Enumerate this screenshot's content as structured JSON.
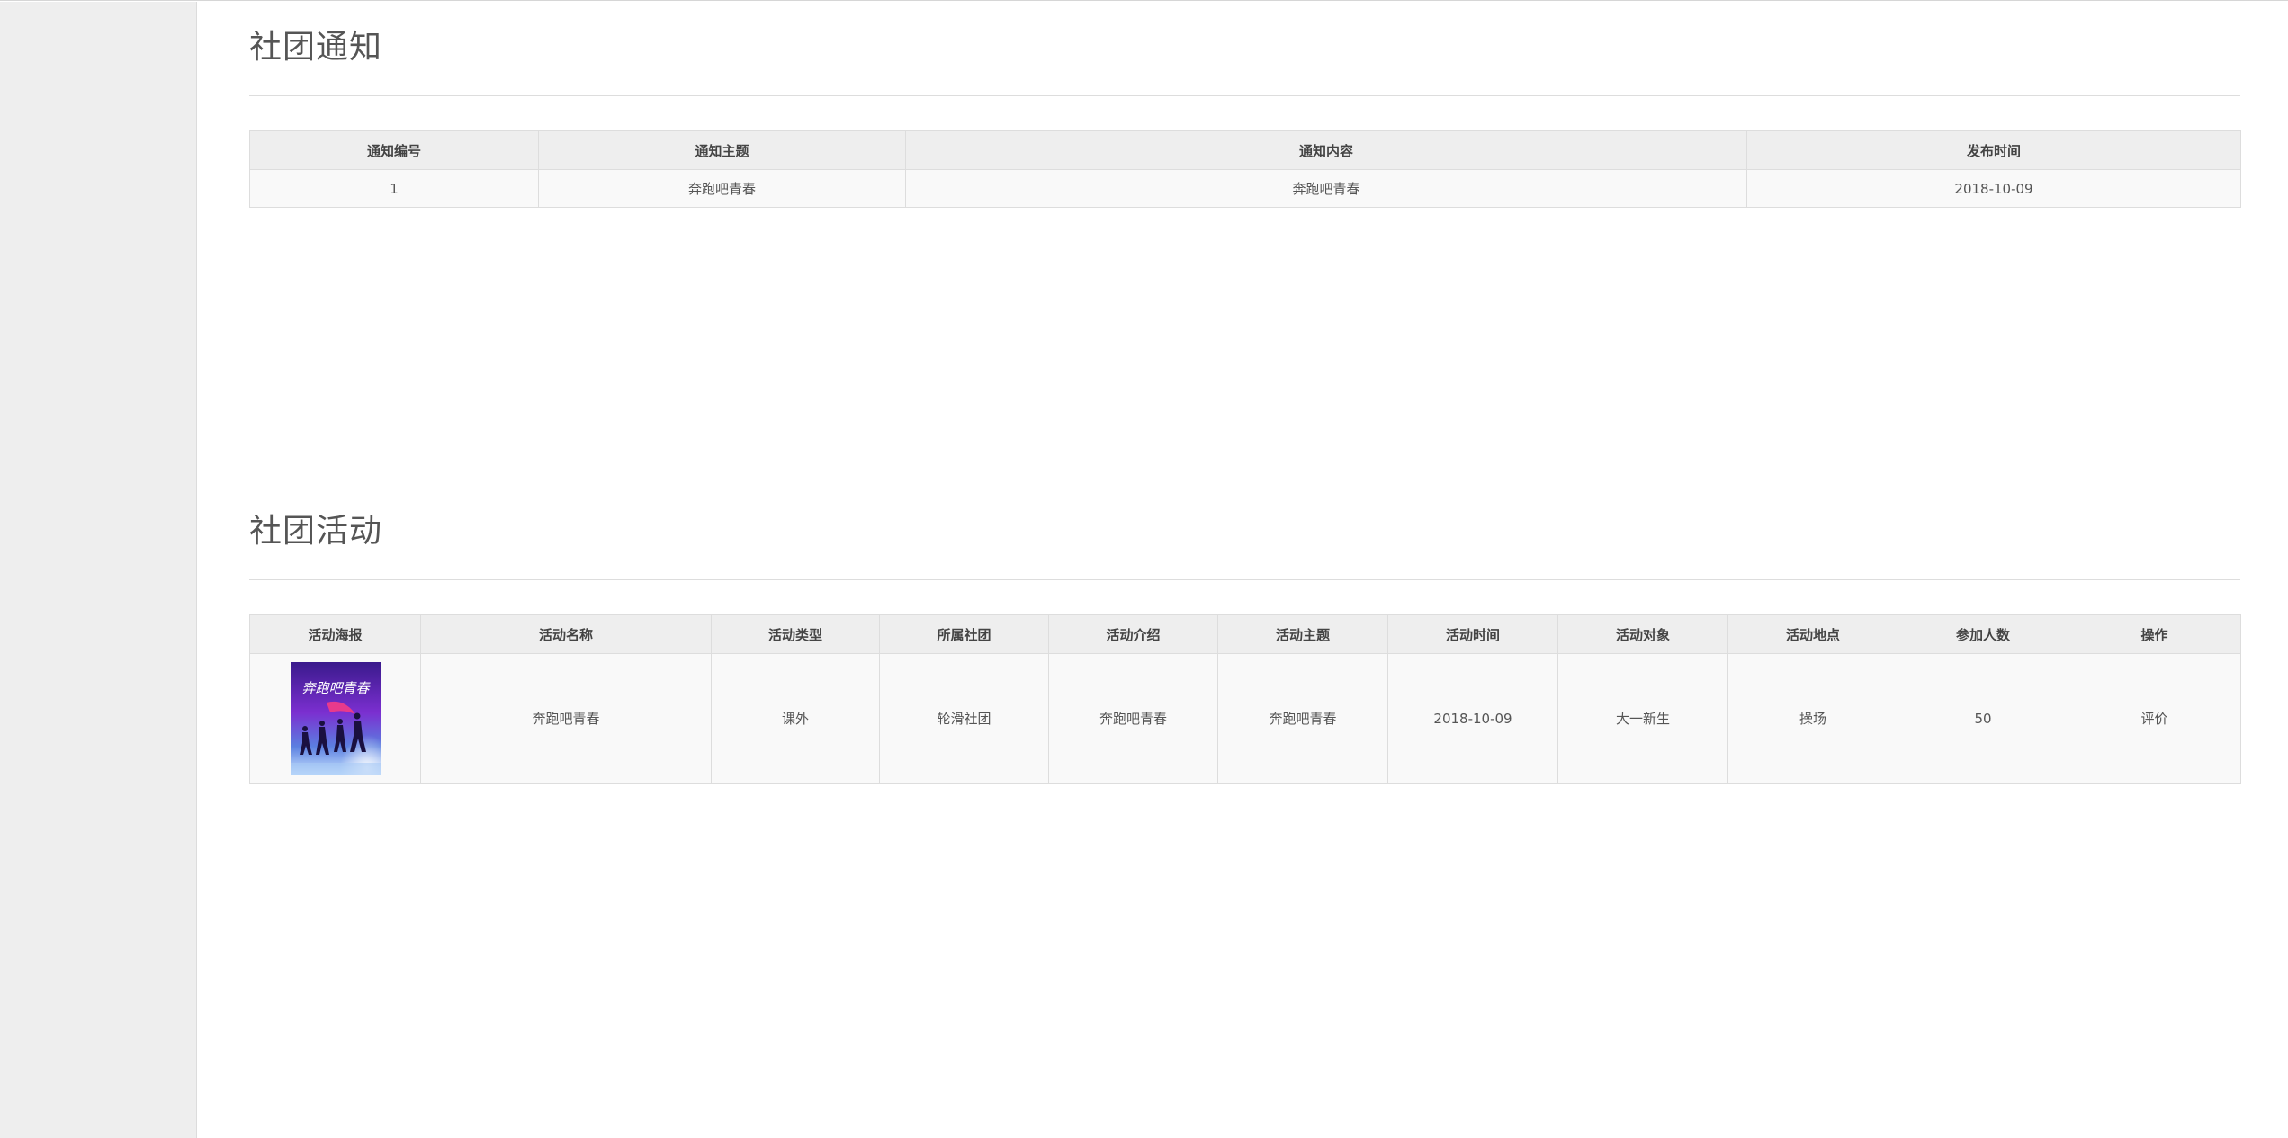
{
  "notice_section": {
    "title": "社团通知",
    "columns": [
      "通知编号",
      "通知主题",
      "通知内容",
      "发布时间"
    ],
    "rows": [
      {
        "id": "1",
        "subject": "奔跑吧青春",
        "content": "奔跑吧青春",
        "date": "2018-10-09"
      }
    ]
  },
  "activity_section": {
    "title": "社团活动",
    "columns": [
      "活动海报",
      "活动名称",
      "活动类型",
      "所属社团",
      "活动介绍",
      "活动主题",
      "活动时间",
      "活动对象",
      "活动地点",
      "参加人数",
      "操作"
    ],
    "rows": [
      {
        "poster_text": "奔跑吧青春",
        "name": "奔跑吧青春",
        "type": "课外",
        "club": "轮滑社团",
        "intro": "奔跑吧青春",
        "theme": "奔跑吧青春",
        "time": "2018-10-09",
        "target": "大一新生",
        "location": "操场",
        "count": "50",
        "action": "评价"
      }
    ]
  },
  "colors": {
    "sidebar_bg": "#eeeeee",
    "header_bg": "#eeeeee",
    "cell_bg": "#f9f9f9",
    "border": "#dddddd",
    "text": "#555555"
  }
}
